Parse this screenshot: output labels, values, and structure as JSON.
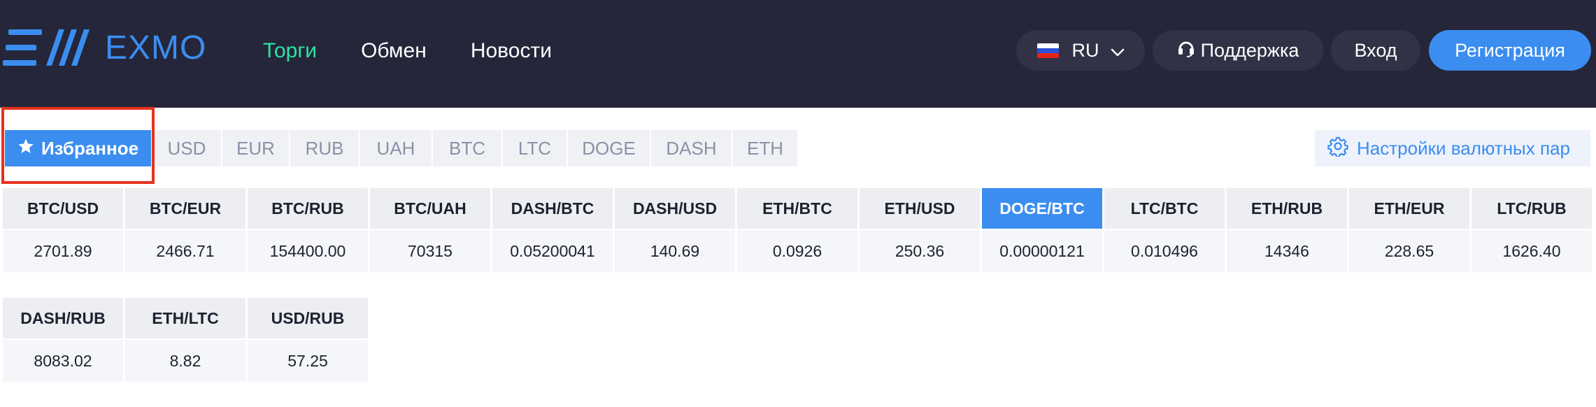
{
  "header": {
    "brand": "EXMO",
    "logo_icon": "exmo-logo-icon",
    "nav": [
      {
        "label": "Торги",
        "active": true
      },
      {
        "label": "Обмен",
        "active": false
      },
      {
        "label": "Новости",
        "active": false
      }
    ],
    "language": {
      "label": "RU",
      "flag_icon": "russia-flag-icon",
      "chevron_icon": "chevron-down-icon"
    },
    "support_label": "Поддержка",
    "support_icon": "headset-icon",
    "login_label": "Вход",
    "register_label": "Регистрация"
  },
  "tabs": {
    "favorites_label": "Избранное",
    "favorites_icon": "star-icon",
    "items": [
      "USD",
      "EUR",
      "RUB",
      "UAH",
      "BTC",
      "LTC",
      "DOGE",
      "DASH",
      "ETH"
    ],
    "active": "Избранное"
  },
  "settings": {
    "label": "Настройки валютных пар",
    "icon": "gear-icon"
  },
  "pairs_row1": [
    {
      "pair": "BTC/USD",
      "value": "2701.89"
    },
    {
      "pair": "BTC/EUR",
      "value": "2466.71"
    },
    {
      "pair": "BTC/RUB",
      "value": "154400.00"
    },
    {
      "pair": "BTC/UAH",
      "value": "70315"
    },
    {
      "pair": "DASH/BTC",
      "value": "0.05200041"
    },
    {
      "pair": "DASH/USD",
      "value": "140.69"
    },
    {
      "pair": "ETH/BTC",
      "value": "0.0926"
    },
    {
      "pair": "ETH/USD",
      "value": "250.36"
    },
    {
      "pair": "DOGE/BTC",
      "value": "0.00000121",
      "selected": true
    },
    {
      "pair": "LTC/BTC",
      "value": "0.010496"
    },
    {
      "pair": "ETH/RUB",
      "value": "14346"
    },
    {
      "pair": "ETH/EUR",
      "value": "228.65"
    },
    {
      "pair": "LTC/RUB",
      "value": "1626.40"
    }
  ],
  "pairs_row2": [
    {
      "pair": "DASH/RUB",
      "value": "8083.02"
    },
    {
      "pair": "ETH/LTC",
      "value": "8.82"
    },
    {
      "pair": "USD/RUB",
      "value": "57.25"
    }
  ],
  "colors": {
    "header_bg": "#25263a",
    "accent_blue": "#3b8df0",
    "active_nav_green": "#2ee2a2",
    "highlight_red": "#e8311f"
  }
}
